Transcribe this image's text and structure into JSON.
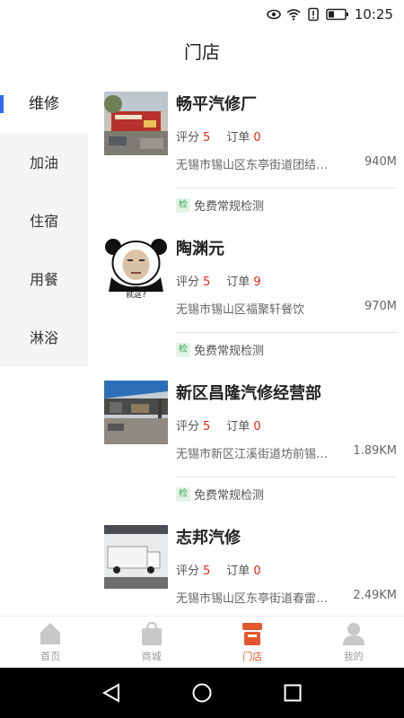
{
  "status_bar": {
    "time": "10:25"
  },
  "header": {
    "title": "门店"
  },
  "sidebar": {
    "items": [
      {
        "label": "维修",
        "active": true
      },
      {
        "label": "加油",
        "active": false
      },
      {
        "label": "住宿",
        "active": false
      },
      {
        "label": "用餐",
        "active": false
      },
      {
        "label": "淋浴",
        "active": false
      }
    ]
  },
  "shops": [
    {
      "name": "畅平汽修厂",
      "rating_label": "评分",
      "rating": "5",
      "orders_label": "订单",
      "orders": "0",
      "address": "无锡市锡山区东亭街道团结…",
      "distance": "940M",
      "tag": "检",
      "service": "免费常规检测"
    },
    {
      "name": "陶渊元",
      "rating_label": "评分",
      "rating": "5",
      "orders_label": "订单",
      "orders": "9",
      "address": "无锡市锡山区福聚轩餐饮",
      "distance": "970M",
      "tag": "检",
      "service": "免费常规检测",
      "thumb_caption": "就这?"
    },
    {
      "name": "新区昌隆汽修经营部",
      "rating_label": "评分",
      "rating": "5",
      "orders_label": "订单",
      "orders": "0",
      "address": "无锡市新区江溪街道坊前锡…",
      "distance": "1.89KM",
      "tag": "检",
      "service": "免费常规检测"
    },
    {
      "name": "志邦汽修",
      "rating_label": "评分",
      "rating": "5",
      "orders_label": "订单",
      "orders": "0",
      "address": "无锡市锡山区东亭街道春雷…",
      "distance": "2.49KM"
    }
  ],
  "tabbar": {
    "items": [
      {
        "label": "首页",
        "icon": "home-icon",
        "active": false
      },
      {
        "label": "商城",
        "icon": "shopping-bag-icon",
        "active": false
      },
      {
        "label": "门店",
        "icon": "store-icon",
        "active": true
      },
      {
        "label": "我的",
        "icon": "user-icon",
        "active": false
      }
    ]
  },
  "colors": {
    "accent": "#e4572e",
    "highlight_number": "#e0261a",
    "sidebar_indicator": "#2e6cf6"
  }
}
